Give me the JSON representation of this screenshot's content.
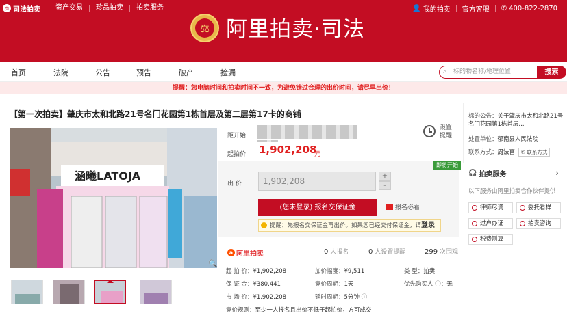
{
  "topbar": {
    "brand": "司法拍卖",
    "links": [
      "资产交易",
      "珍品拍卖",
      "拍卖服务"
    ],
    "my_auction": "我的拍卖",
    "service": "官方客服",
    "phone": "400-822-2870"
  },
  "header": {
    "title": "阿里拍卖·司法"
  },
  "nav": {
    "items": [
      "首页",
      "法院",
      "公告",
      "预告",
      "破产",
      "捡漏"
    ],
    "search_placeholder": "标的物名称/地理位置",
    "search_button": "搜索"
  },
  "notice": "提醒：您电脑时间和拍卖时间不一致，为避免错过合理的出价时间，请尽早出价！",
  "item": {
    "title": "【第一次拍卖】肇庆市太和北路21号名门花园第1栋首层及第二层第17卡的商铺",
    "countdown_label": "距开始",
    "start_price_label": "起拍价",
    "start_price": "1,902,208",
    "price_unit": "元",
    "remind_label": "设置提醒",
    "soon_badge": "即将开始",
    "bid_label": "出 价",
    "bid_value": "1,902,208",
    "plus": "+",
    "minus": "-",
    "sign_button": "(您未登录) 报名交保证金",
    "must_read": "报名必看",
    "tip_text": "提醒：先报名交保证金再出价。如果您已经交付保证金，请",
    "tip_login": "登录"
  },
  "stats": {
    "platform": "阿里拍卖",
    "signup_count": "0",
    "signup_label": "人报名",
    "remind_count": "0",
    "remind_label": "人设置提醒",
    "view_count": "299",
    "view_label": "次围观"
  },
  "info": {
    "start_price": {
      "k": "起 拍 价：",
      "v": "¥1,902,208"
    },
    "deposit": {
      "k": "保 证 金：",
      "v": "¥380,441"
    },
    "market_price": {
      "k": "市 场 价：",
      "v": "¥1,902,208"
    },
    "increment": {
      "k": "加价幅度：",
      "v": "¥9,511"
    },
    "period": {
      "k": "竞价周期：",
      "v": "1天"
    },
    "delay": {
      "k": "延时周期：",
      "v": "5分钟"
    },
    "type": {
      "k": "类 型：",
      "v": "拍卖"
    },
    "priority": {
      "k": "优先购买人",
      "v": "：无"
    },
    "rule": {
      "k": "竞价规则：",
      "v": "至少一人报名且出价不低于起拍价，方可成交"
    }
  },
  "sidebar": {
    "announcement_label": "标的公告：",
    "announcement": "关于肇庆市太和北路21号名门花园第1栋首层...",
    "unit_label": "处置单位：",
    "unit": "郁南县人民法院",
    "contact_label": "联系方式：",
    "contact": "周法官",
    "contact_btn": "联系方式",
    "service_title": "拍卖服务",
    "service_sub": "以下服务由阿里拍卖合作伙伴提供",
    "services": [
      "律师尽调",
      "委托看样",
      "过户办证",
      "拍卖咨询",
      "税费测算"
    ]
  },
  "photo": {
    "sign_text": "涵曦LATOJA"
  }
}
